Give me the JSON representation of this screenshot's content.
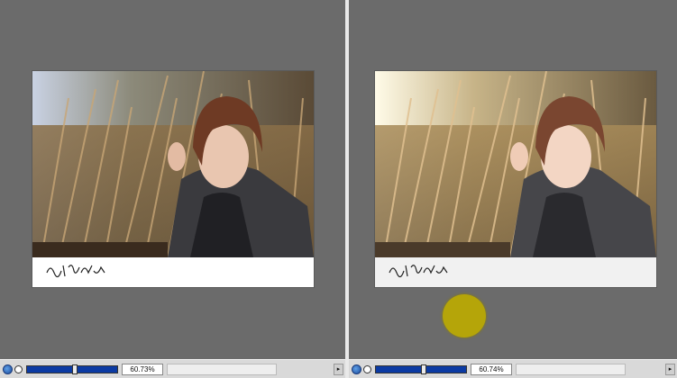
{
  "panes": [
    {
      "id": "before",
      "zoom": "60.73%"
    },
    {
      "id": "after",
      "zoom": "60.74%"
    }
  ],
  "statusbar": {
    "globe_icon": "globe-icon",
    "zoom_icon": "magnifier-icon",
    "arrow_glyph": "▸"
  },
  "colors": {
    "canvas_bg": "#6b6b6b",
    "divider": "#e9e9e9",
    "cursor_dot": "#b5a509"
  }
}
